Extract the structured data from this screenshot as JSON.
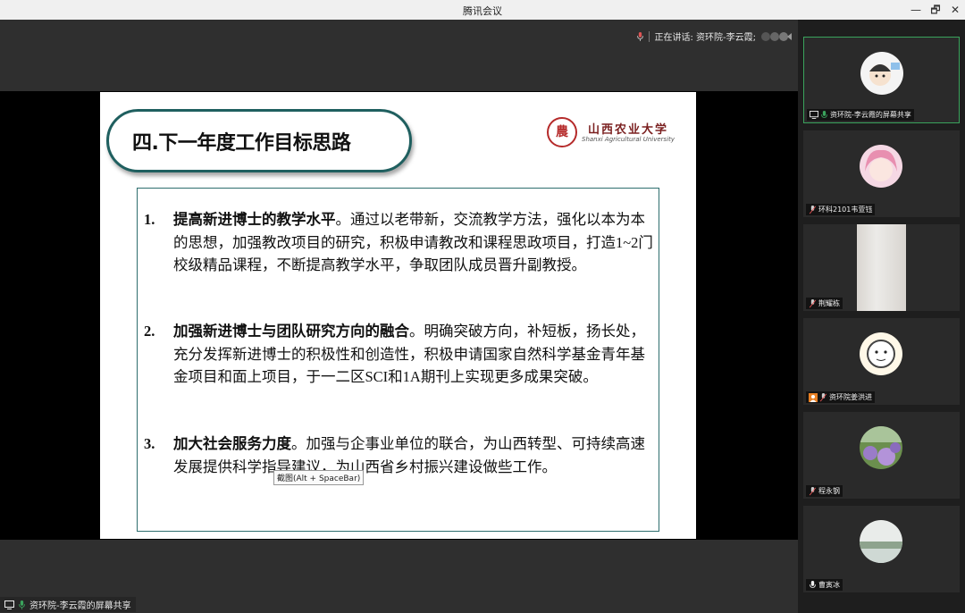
{
  "window": {
    "title": "腾讯会议",
    "controls": [
      "—",
      "🗗",
      "✕"
    ]
  },
  "speaking": {
    "text": "正在讲话: 资环院-李云霞;"
  },
  "slide": {
    "title": "四.下一年度工作目标思路",
    "logo": {
      "cn": "山西农业大学",
      "en": "Shanxi Agricultural University",
      "seal_char": "農"
    },
    "items": [
      {
        "num": "1.",
        "bold": "提高新进博士的教学水平",
        "text": "。通过以老带新，交流教学方法，强化以本为本的思想，加强教改项目的研究，积极申请教改和课程思政项目，打造1~2门校级精品课程，不断提高教学水平，争取团队成员晋升副教授。"
      },
      {
        "num": "2.",
        "bold": "加强新进博士与团队研究方向的融合",
        "text": "。明确突破方向，补短板，扬长处，充分发挥新进博士的积极性和创造性，积极申请国家自然科学基金青年基金项目和面上项目，于一二区SCI和1A期刊上实现更多成果突破。"
      },
      {
        "num": "3.",
        "bold": "加大社会服务力度",
        "text": "。加强与企事业单位的联合，为山西转型、可持续高速发展提供科学指导建议，为山西省乡村振兴建设做些工作。"
      }
    ]
  },
  "tooltip": "截图(Alt + SpaceBar)",
  "bottom_label": "资环院-李云霞的屏幕共享",
  "participants": [
    {
      "name": "资环院-李云霞的屏幕共享",
      "avatar_icon": "cartoon-boy-avatar",
      "accent": "#3aa35c"
    },
    {
      "name": "环科2101韦萱钰",
      "avatar_icon": "anime-girl-avatar",
      "accent": "#e88fb0"
    },
    {
      "name": "荆耀栋",
      "avatar_icon": "video-feed",
      "accent": "#d9d5d0"
    },
    {
      "name": "资环院姜洪进",
      "avatar_icon": "cartoon-face-avatar",
      "accent": "#f0c070"
    },
    {
      "name": "程永钢",
      "avatar_icon": "flower-field-avatar",
      "accent": "#9a7cc8"
    },
    {
      "name": "曹寅冰",
      "avatar_icon": "landscape-avatar",
      "accent": "#cfd9d4"
    }
  ]
}
